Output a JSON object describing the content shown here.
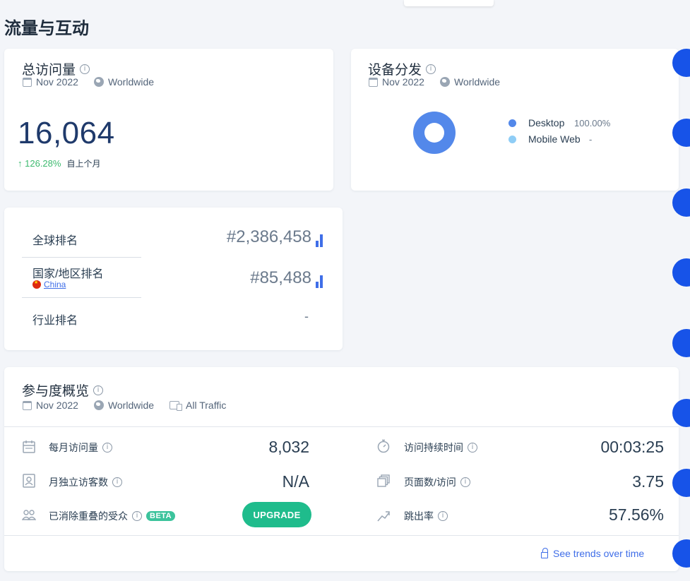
{
  "page": {
    "title": "流量与互动"
  },
  "total_visits": {
    "title": "总访问量",
    "date": "Nov 2022",
    "region": "Worldwide",
    "value": "16,064",
    "change_arrow": "↑",
    "change_pct": "126.28%",
    "change_since": "自上个月"
  },
  "device": {
    "title": "设备分发",
    "date": "Nov 2022",
    "region": "Worldwide",
    "legend": [
      {
        "label": "Desktop",
        "value": "100.00%",
        "color": "#5388ea"
      },
      {
        "label": "Mobile Web",
        "value": "-",
        "color": "#8fcdf6"
      }
    ]
  },
  "ranks": {
    "global_label": "全球排名",
    "global_value": "#2,386,458",
    "country_label": "国家/地区排名",
    "country_name": "China",
    "country_value": "#85,488",
    "industry_label": "行业排名",
    "industry_value": "-"
  },
  "engagement": {
    "title": "参与度概览",
    "date": "Nov 2022",
    "region": "Worldwide",
    "traffic": "All Traffic",
    "monthly_visits_label": "每月访问量",
    "monthly_visits_value": "8,032",
    "unique_visitors_label": "月独立访客数",
    "unique_visitors_value": "N/A",
    "dedup_label": "已消除重叠的受众",
    "beta": "BETA",
    "upgrade": "UPGRADE",
    "duration_label": "访问持续时间",
    "duration_value": "00:03:25",
    "pages_label": "页面数/访问",
    "pages_value": "3.75",
    "bounce_label": "跳出率",
    "bounce_value": "57.56%",
    "trends_link": "See trends over time"
  },
  "icons": {
    "info": "i",
    "calendar": "calendar-icon",
    "globe": "globe-icon",
    "lock": "lock-icon"
  },
  "colors": {
    "accent": "#3f6ee8",
    "positive": "#3dba6f",
    "upgrade": "#1fbc8c",
    "edge_tab": "#1753e8"
  }
}
